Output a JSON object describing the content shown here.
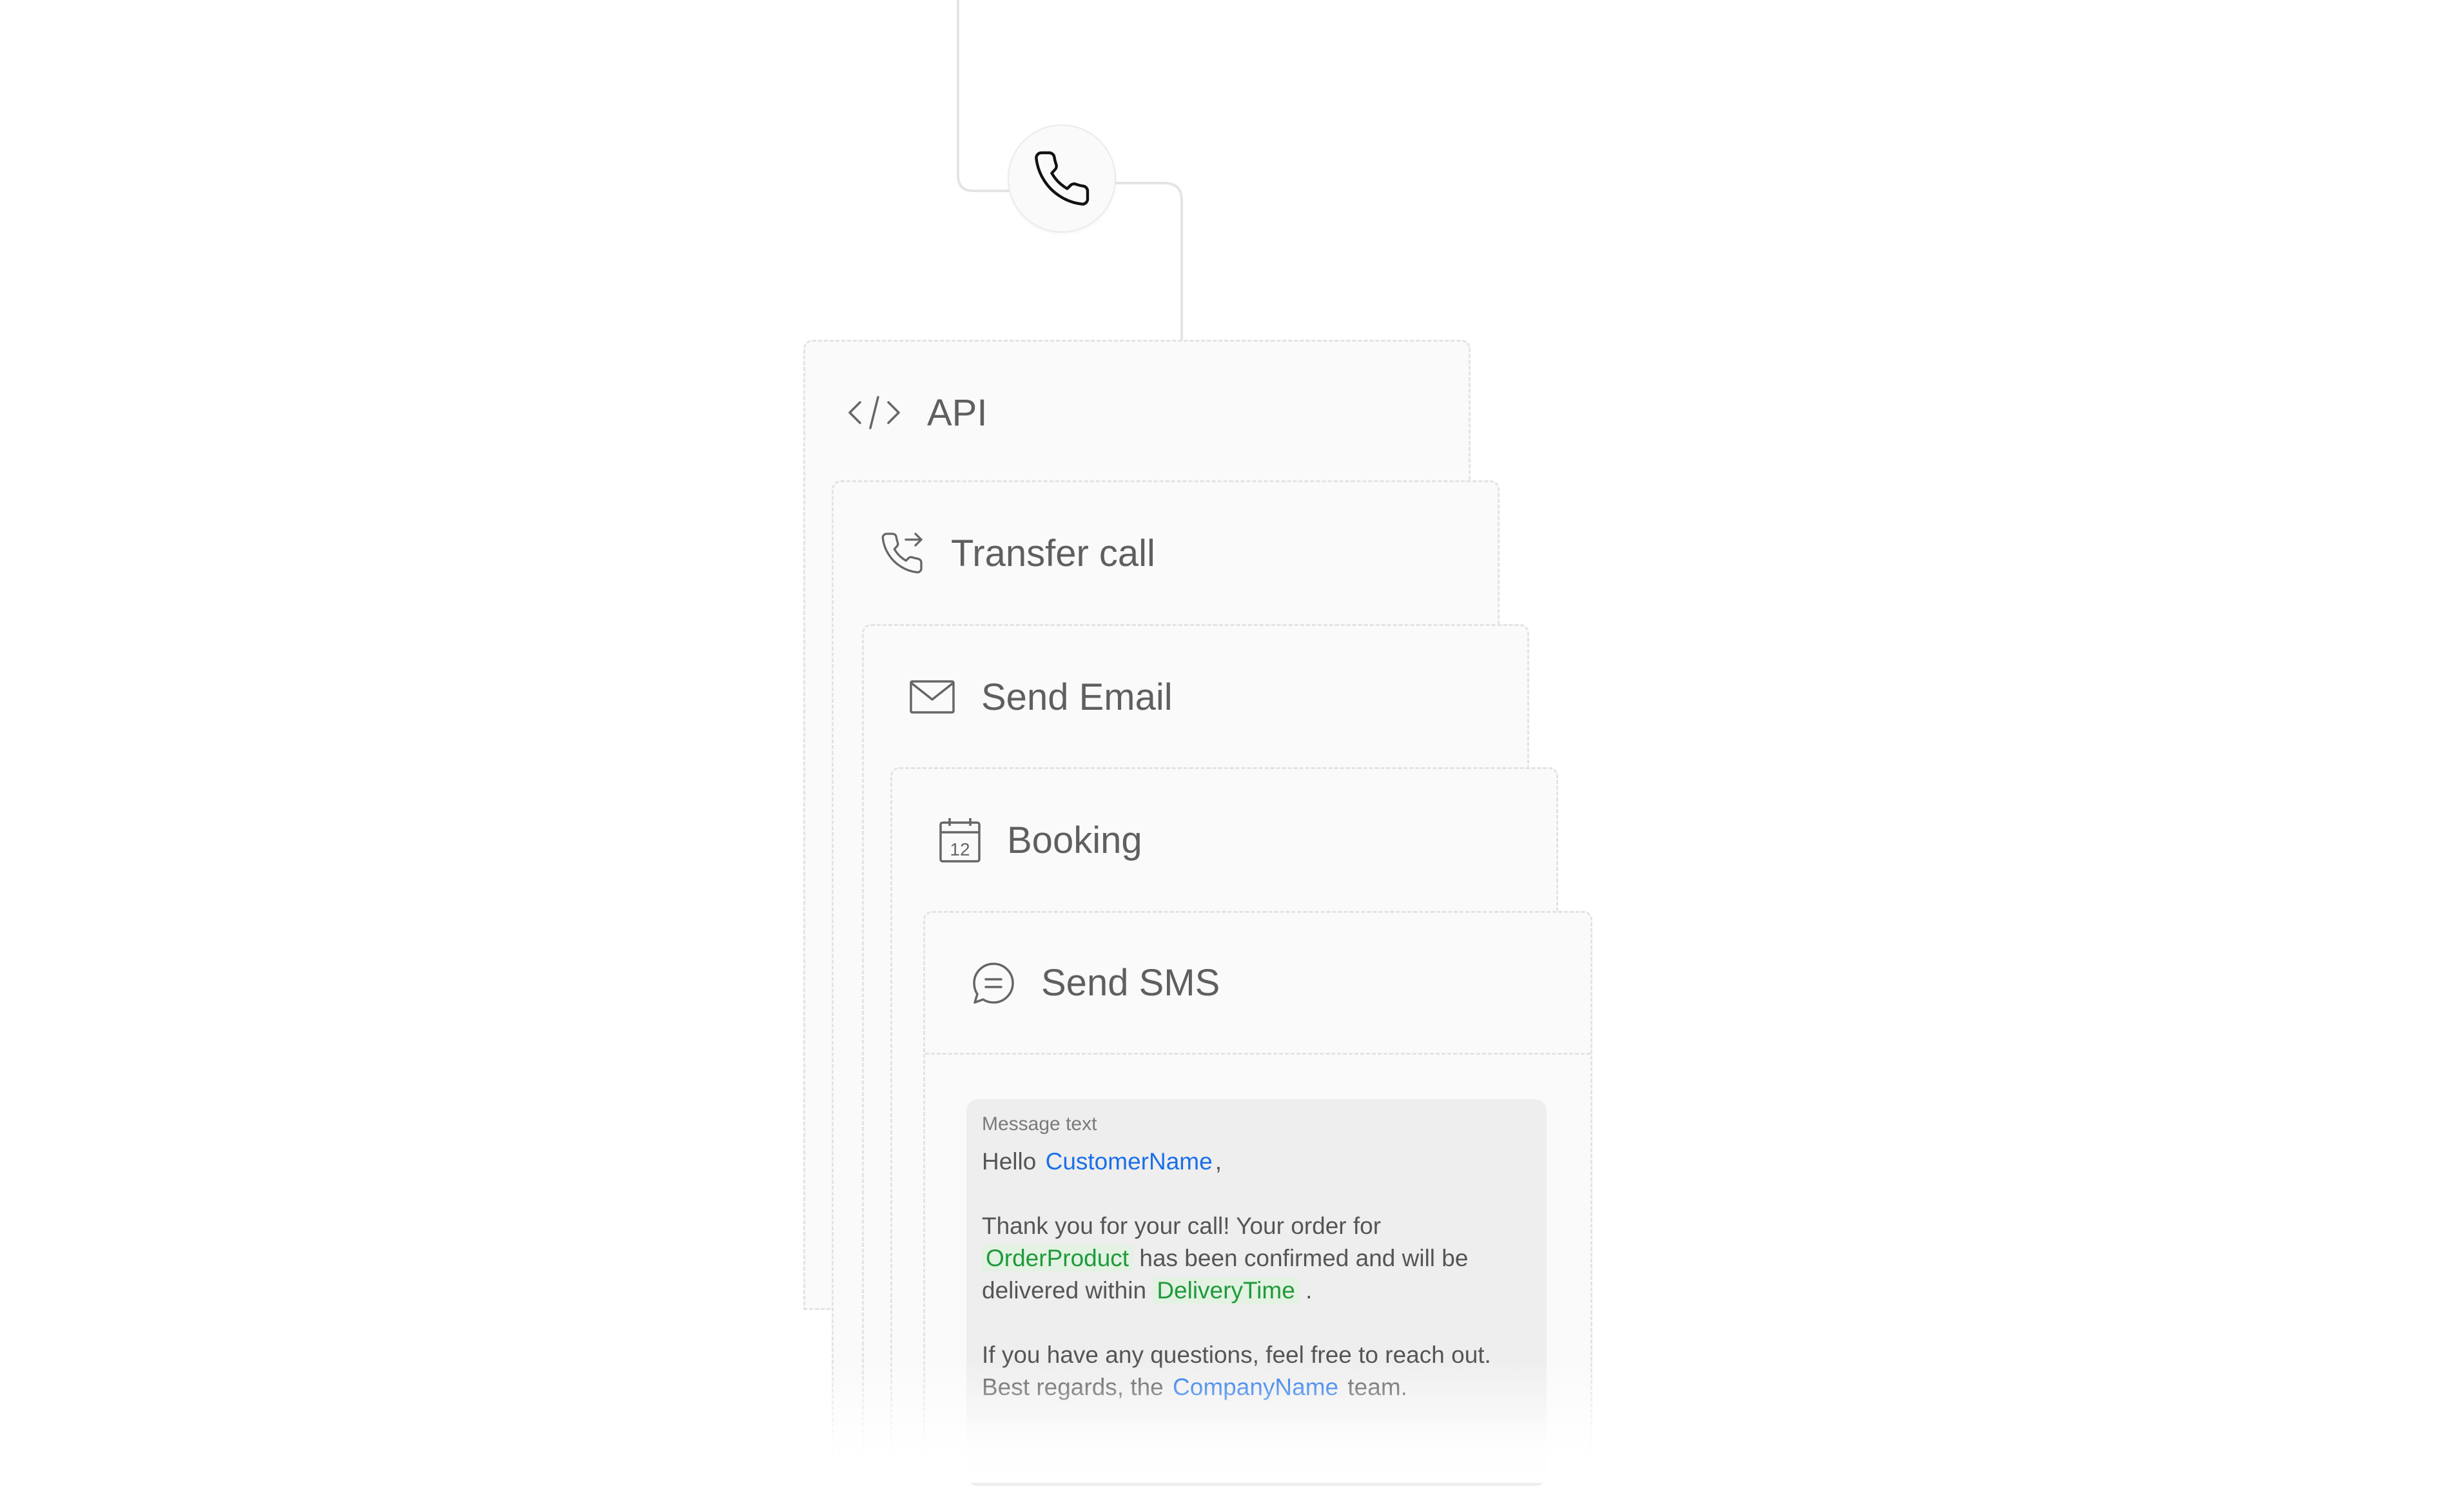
{
  "actions": [
    {
      "id": "api",
      "label": "API",
      "icon": "code-icon"
    },
    {
      "id": "transfer",
      "label": "Transfer call",
      "icon": "phone-transfer-icon"
    },
    {
      "id": "email",
      "label": "Send Email",
      "icon": "mail-icon"
    },
    {
      "id": "booking",
      "label": "Booking",
      "icon": "calendar-icon",
      "icon_text": "12"
    },
    {
      "id": "sms",
      "label": "Send SMS",
      "icon": "chat-bubble-icon"
    }
  ],
  "trigger": {
    "icon": "phone-icon"
  },
  "message": {
    "label": "Message text",
    "greeting": "Hello",
    "customer_var": "CustomerName",
    "greeting_end": ",",
    "line2": "Thank you for your call! Your order for",
    "product_var": "OrderProduct",
    "line3_text": "has been confirmed and will be",
    "line4_text": "delivered within",
    "delivery_var": "DeliveryTime",
    "line4_end": ".",
    "line5": "If you have any questions, feel free to reach out.",
    "line6_start": "Best regards, the",
    "company_var": "CompanyName",
    "line6_end": "team."
  },
  "colors": {
    "variable_blue": "#1a6fe8",
    "variable_green": "#1e9a3b",
    "text": "#5f5f5f"
  }
}
